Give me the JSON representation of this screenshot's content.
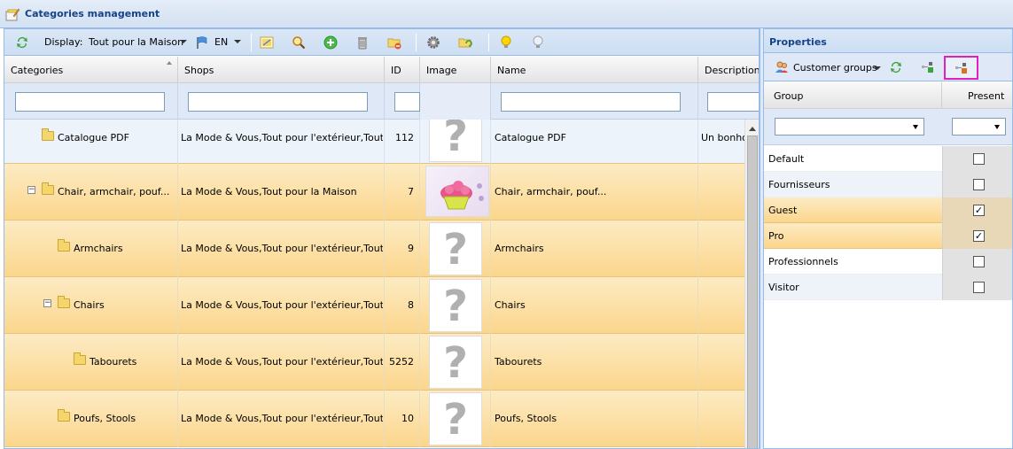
{
  "window": {
    "title": "Categories management"
  },
  "toolbar": {
    "display_label": "Display:",
    "shop_selected": "Tout pour la Maison",
    "language": "EN"
  },
  "grid": {
    "columns": [
      "Categories",
      "Shops",
      "ID",
      "Image",
      "Name",
      "Description"
    ],
    "rows": [
      {
        "category": "Catalogue PDF",
        "shops": "La Mode & Vous,Tout pour l'extérieur,Tout pour",
        "id": "112",
        "image": "placeholder",
        "name": "Catalogue PDF",
        "description": "Un bonhor",
        "depth": 0,
        "expander": ""
      },
      {
        "category": "Chair, armchair, pouf...",
        "shops": "La Mode & Vous,Tout pour la Maison",
        "id": "7",
        "image": "photo",
        "name": "Chair, armchair, pouf...",
        "description": "",
        "depth": 0,
        "expander": "−"
      },
      {
        "category": "Armchairs",
        "shops": "La Mode & Vous,Tout pour l'extérieur,Tout pour",
        "id": "9",
        "image": "placeholder",
        "name": "Armchairs",
        "description": "",
        "depth": 1,
        "expander": ""
      },
      {
        "category": "Chairs",
        "shops": "La Mode & Vous,Tout pour l'extérieur,Tout pour",
        "id": "8",
        "image": "placeholder",
        "name": "Chairs",
        "description": "",
        "depth": 1,
        "expander": "−"
      },
      {
        "category": "Tabourets",
        "shops": "La Mode & Vous,Tout pour l'extérieur,Tout pour",
        "id": "5252",
        "image": "placeholder",
        "name": "Tabourets",
        "description": "",
        "depth": 2,
        "expander": ""
      },
      {
        "category": "Poufs, Stools",
        "shops": "La Mode & Vous,Tout pour l'extérieur,Tout pour",
        "id": "10",
        "image": "placeholder",
        "name": "Poufs, Stools",
        "description": "",
        "depth": 1,
        "expander": ""
      }
    ]
  },
  "properties": {
    "title": "Properties",
    "dropdown_label": "Customer groups",
    "columns": [
      "Group",
      "Present"
    ],
    "groups": [
      {
        "name": "Default",
        "present": false
      },
      {
        "name": "Fournisseurs",
        "present": false
      },
      {
        "name": "Guest",
        "present": true
      },
      {
        "name": "Pro",
        "present": true
      },
      {
        "name": "Professionnels",
        "present": false
      },
      {
        "name": "Visitor",
        "present": false
      }
    ]
  },
  "icons": {
    "check": "✓",
    "question": "?"
  },
  "colors": {
    "header_text": "#15428b",
    "selected_row": "#fbd68c",
    "highlight_border": "#e020c0"
  }
}
